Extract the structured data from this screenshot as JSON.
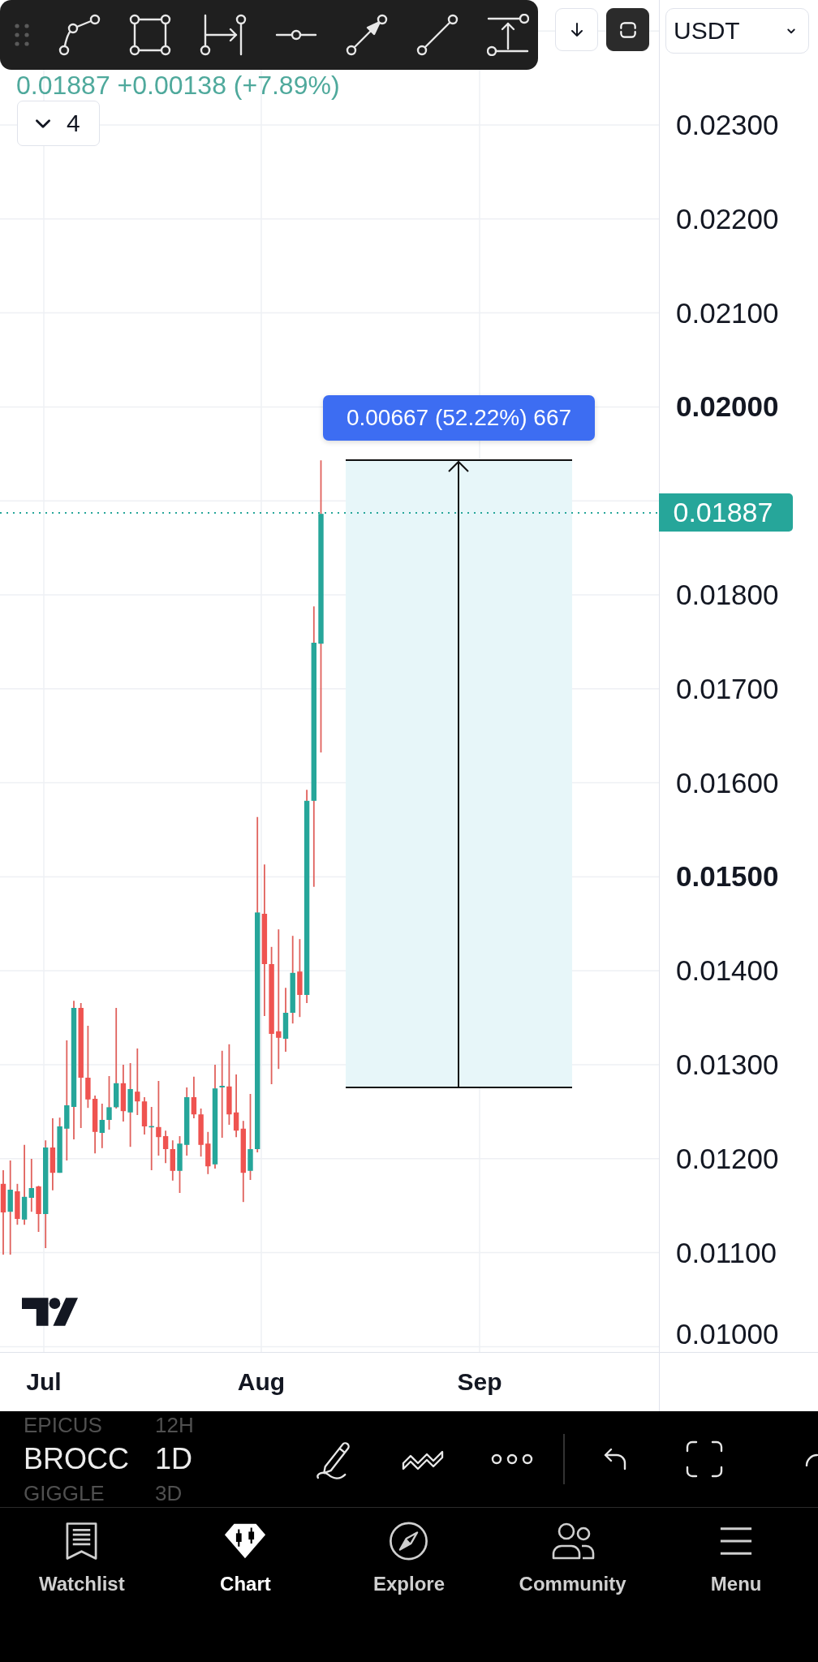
{
  "drawing_toolbar": {
    "tools": [
      {
        "kind": "path"
      },
      {
        "kind": "rectangle"
      },
      {
        "kind": "date-range"
      },
      {
        "kind": "horizontal-line"
      },
      {
        "kind": "arrow"
      },
      {
        "kind": "trend-line"
      },
      {
        "kind": "price-range"
      }
    ]
  },
  "header_buttons": [
    {
      "kind": "scroll-down",
      "active": false
    },
    {
      "kind": "drawing-mode",
      "active": true
    }
  ],
  "currency_select": {
    "value": "USDT"
  },
  "quote": {
    "text": "0.01887 +0.00138 (+7.89%)"
  },
  "indicators_toggle": {
    "count": "4",
    "expanded": false
  },
  "measurement": {
    "label": "0.00667 (52.22%) 667"
  },
  "price_axis": {
    "labels": [
      {
        "text": "0.02300",
        "emphasized": false
      },
      {
        "text": "0.02200",
        "emphasized": false
      },
      {
        "text": "0.02100",
        "emphasized": false
      },
      {
        "text": "0.02000",
        "emphasized": true
      },
      {
        "text": "0.01800",
        "emphasized": false
      },
      {
        "text": "0.01700",
        "emphasized": false
      },
      {
        "text": "0.01600",
        "emphasized": false
      },
      {
        "text": "0.01500",
        "emphasized": true
      },
      {
        "text": "0.01400",
        "emphasized": false
      },
      {
        "text": "0.01300",
        "emphasized": false
      },
      {
        "text": "0.01200",
        "emphasized": false
      },
      {
        "text": "0.01100",
        "emphasized": false
      },
      {
        "text": "0.01000",
        "emphasized": false
      }
    ],
    "last_price": "0.01887"
  },
  "time_axis": {
    "labels": [
      "Jul",
      "Aug",
      "Sep"
    ]
  },
  "bottom_toolbar": {
    "symbols": [
      {
        "label": "EPICUS",
        "selected": false
      },
      {
        "label": "BROCC",
        "selected": true
      },
      {
        "label": "GIGGLE",
        "selected": false
      }
    ],
    "intervals": [
      {
        "label": "12H",
        "selected": false
      },
      {
        "label": "1D",
        "selected": true
      },
      {
        "label": "3D",
        "selected": false
      }
    ],
    "tools": [
      {
        "kind": "draw"
      },
      {
        "kind": "patterns"
      },
      {
        "kind": "more"
      },
      {
        "kind": "divider"
      },
      {
        "kind": "undo"
      },
      {
        "kind": "fullscreen"
      },
      {
        "kind": "partial"
      }
    ]
  },
  "nav": {
    "items": [
      {
        "label": "Watchlist",
        "kind": "watchlist",
        "selected": false
      },
      {
        "label": "Chart",
        "kind": "chart",
        "selected": true
      },
      {
        "label": "Explore",
        "kind": "explore",
        "selected": false
      },
      {
        "label": "Community",
        "kind": "community",
        "selected": false
      },
      {
        "label": "Menu",
        "kind": "menu",
        "selected": false
      }
    ]
  }
}
